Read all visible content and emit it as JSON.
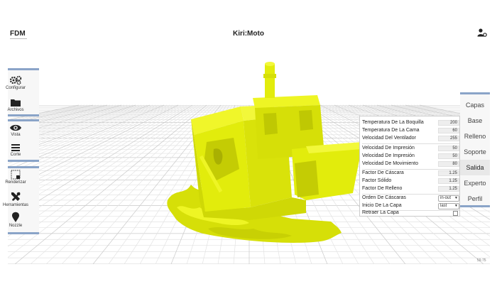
{
  "header": {
    "mode": "FDM",
    "title": "Kiri:Moto"
  },
  "toolbar": {
    "configure_label": "Configurar",
    "files_label": "Archivos",
    "view_label": "Vista",
    "slice_label": "Corte",
    "render_label": "Renderizar",
    "tools_label": "Herramientas",
    "nozzle_label": "Nozzle"
  },
  "tabs": [
    "Capas",
    "Base",
    "Relleno",
    "Soporte",
    "Salida",
    "Experto",
    "Perfil"
  ],
  "active_tab": "Salida",
  "settings": {
    "nozzle_temp": {
      "label": "Temperatura De La Boquilla",
      "value": "200"
    },
    "bed_temp": {
      "label": "Temperatura De La Cama",
      "value": "60"
    },
    "fan_speed": {
      "label": "Velocidad Del Ventilador",
      "value": "255"
    },
    "print_speed_1": {
      "label": "Velocidad De Impresión",
      "value": "50"
    },
    "print_speed_2": {
      "label": "Velocidad De Impresión",
      "value": "50"
    },
    "move_speed": {
      "label": "Velocidad De Movimiento",
      "value": "80"
    },
    "shell_factor": {
      "label": "Factor De Cáscara",
      "value": "1.25"
    },
    "solid_factor": {
      "label": "Factor Sólido",
      "value": "1.25"
    },
    "fill_factor": {
      "label": "Factor De Relleno",
      "value": "1.25"
    },
    "shell_order": {
      "label": "Orden De Cáscaras",
      "value": "in-out"
    },
    "layer_start": {
      "label": "Inicio De La Capa",
      "value": "last"
    },
    "retract_layer": {
      "label": "Retraer La Capa",
      "checked": false
    }
  },
  "status": {
    "value": "59.75"
  },
  "colors": {
    "model": "#e2ec0c",
    "accent": "#8aa4c8"
  }
}
